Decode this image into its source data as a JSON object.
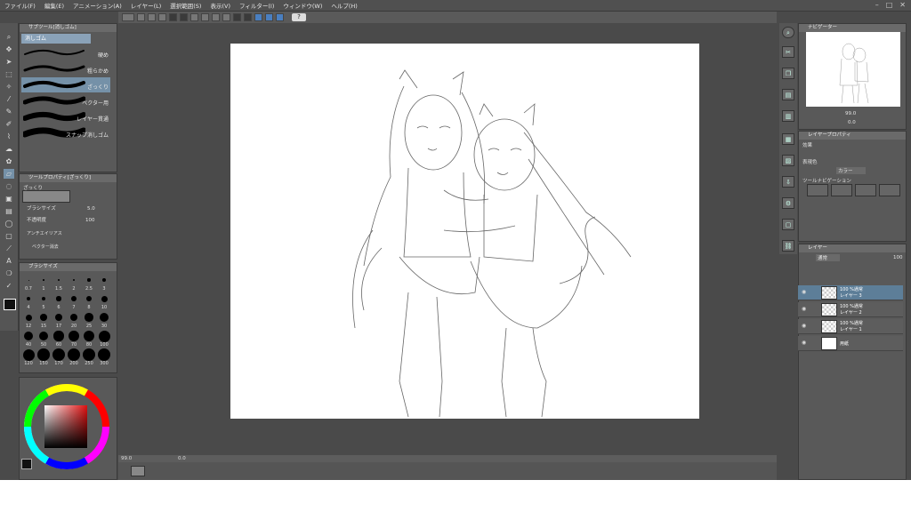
{
  "menu": [
    "ファイル(F)",
    "編集(E)",
    "アニメーション(A)",
    "レイヤー(L)",
    "選択範囲(S)",
    "表示(V)",
    "フィルター(I)",
    "ウィンドウ(W)",
    "ヘルプ(H)"
  ],
  "subtool": {
    "header": "サブツール[消しゴム]",
    "selected": "消しゴム",
    "items": [
      "硬め",
      "粗らかめ",
      "ざっくり",
      "ベクター用",
      "レイヤー貫通",
      "スナップ消しゴム"
    ]
  },
  "tool_property": {
    "header": "ツールプロパティ[ざっくり]",
    "name": "ざっくり",
    "brush_size_label": "ブラシサイズ",
    "brush_size_value": "5.0",
    "opacity_label": "不透明度",
    "opacity_value": "100",
    "antialias_label": "アンチエイリアス",
    "vector_label": "ベクター消去"
  },
  "brush_size_panel": {
    "header": "ブラシサイズ",
    "sizes": [
      "0.7",
      "1",
      "1.5",
      "2",
      "2.5",
      "3",
      "4",
      "5",
      "6",
      "7",
      "8",
      "10",
      "12",
      "15",
      "17",
      "20",
      "25",
      "30",
      "40",
      "50",
      "60",
      "70",
      "80",
      "100",
      "120",
      "150",
      "170",
      "200",
      "250",
      "300"
    ]
  },
  "navigator": {
    "header": "ナビゲーター",
    "zoom": "99.0",
    "rotate": "0.0"
  },
  "layer_property": {
    "header": "レイヤープロパティ",
    "effect_label": "効果",
    "display_color_label": "表現色",
    "display_color_value": "カラー",
    "tool_nav_label": "ツールナビゲーション"
  },
  "layers": {
    "header": "レイヤー",
    "blend": "通常",
    "opacity": "100",
    "items": [
      {
        "mode": "100 %通常",
        "name": "レイヤー 3",
        "selected": true
      },
      {
        "mode": "100 %通常",
        "name": "レイヤー 2",
        "selected": false
      },
      {
        "mode": "100 %通常",
        "name": "レイヤー 1",
        "selected": false
      },
      {
        "mode": "",
        "name": "用紙",
        "selected": false
      }
    ]
  },
  "statusbar": {
    "zoom": "99.0",
    "rotate": "0.0"
  },
  "colors": {
    "accent": "#7591a8",
    "selection": "#5d7e98",
    "panel": "#595959"
  }
}
